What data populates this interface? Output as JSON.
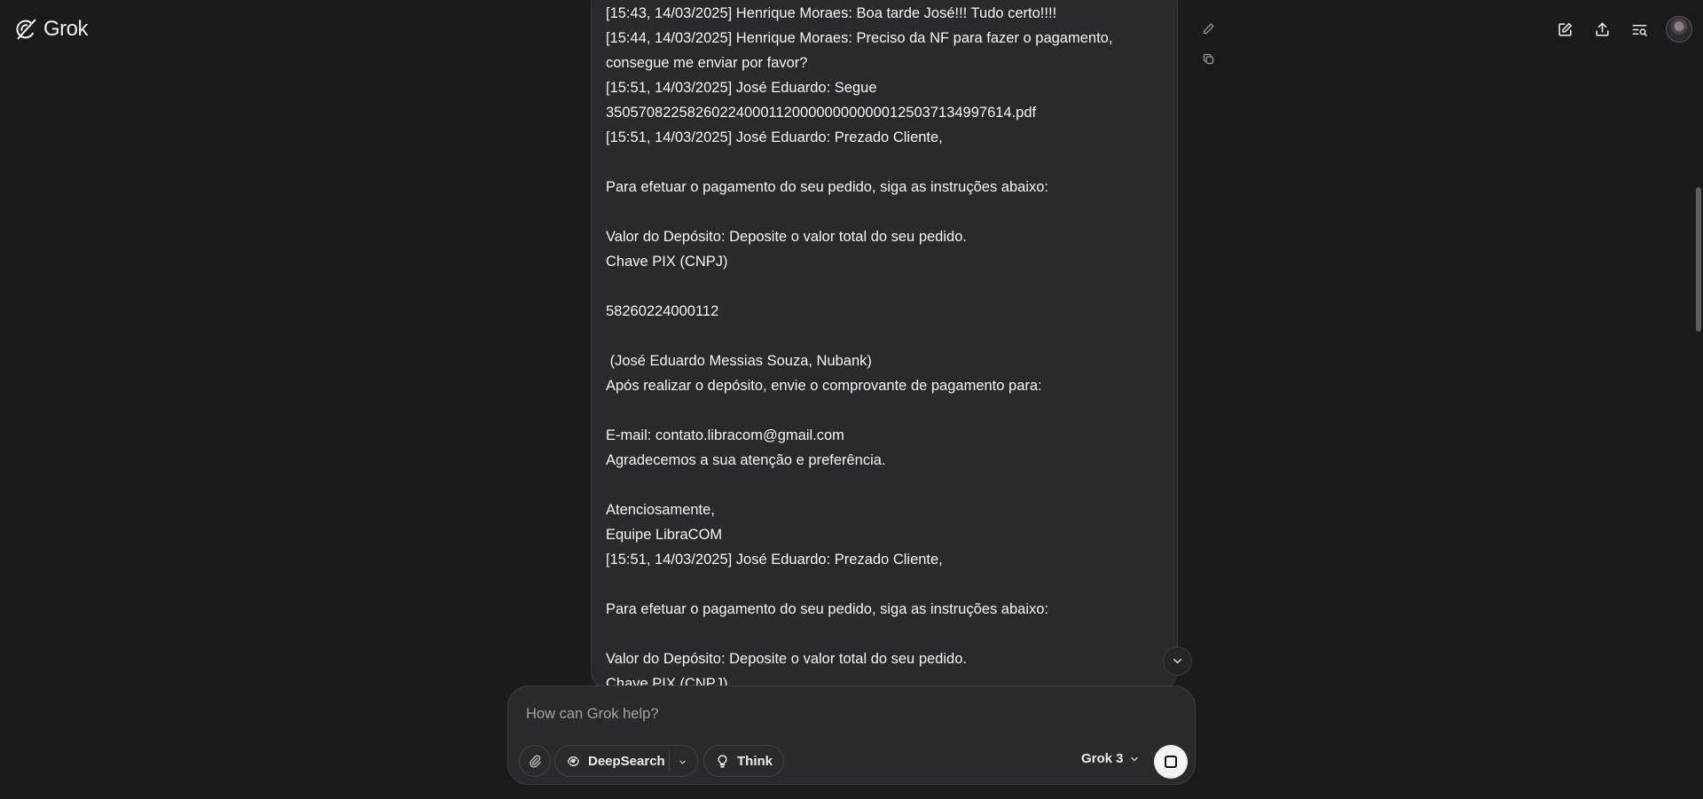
{
  "app": {
    "name": "Grok"
  },
  "header": {
    "icons": [
      "pencil-square-icon",
      "share-upload-icon",
      "search-history-icon",
      "avatar"
    ]
  },
  "message": {
    "lines": [
      "[15:43, 14/03/2025] Henrique Moraes: Boa tarde José!!! Tudo certo!!!!",
      "[15:44, 14/03/2025] Henrique Moraes: Preciso da NF para fazer o pagamento,",
      "consegue me enviar por favor?",
      "[15:51, 14/03/2025] José Eduardo: Segue",
      "35057082258260224000112000000000000125037134997614.pdf",
      "[15:51, 14/03/2025] José Eduardo: Prezado Cliente,",
      "",
      "Para efetuar o pagamento do seu pedido, siga as instruções abaixo:",
      "",
      "Valor do Depósito: Deposite o valor total do seu pedido.",
      "Chave PIX (CNPJ)",
      "",
      "58260224000112",
      "",
      " (José Eduardo Messias Souza, Nubank)",
      "Após realizar o depósito, envie o comprovante de pagamento para:",
      "",
      "E-mail: contato.libracom@gmail.com",
      "Agradecemos a sua atenção e preferência.",
      "",
      "Atenciosamente,",
      "Equipe LibraCOM",
      "[15:51, 14/03/2025] José Eduardo: Prezado Cliente,",
      "",
      "Para efetuar o pagamento do seu pedido, siga as instruções abaixo:",
      "",
      "Valor do Depósito: Deposite o valor total do seu pedido.",
      "Chave PIX (CNPJ)"
    ]
  },
  "composer": {
    "placeholder": "How can Grok help?",
    "deepsearch_label": "DeepSearch",
    "think_label": "Think",
    "model_label": "Grok 3"
  },
  "colors": {
    "background": "#1b1b1b",
    "bubble": "#2a2a2c",
    "text": "#f4f4f4",
    "placeholder": "#a3a3a3",
    "stop_button": "#f3f3f3"
  }
}
